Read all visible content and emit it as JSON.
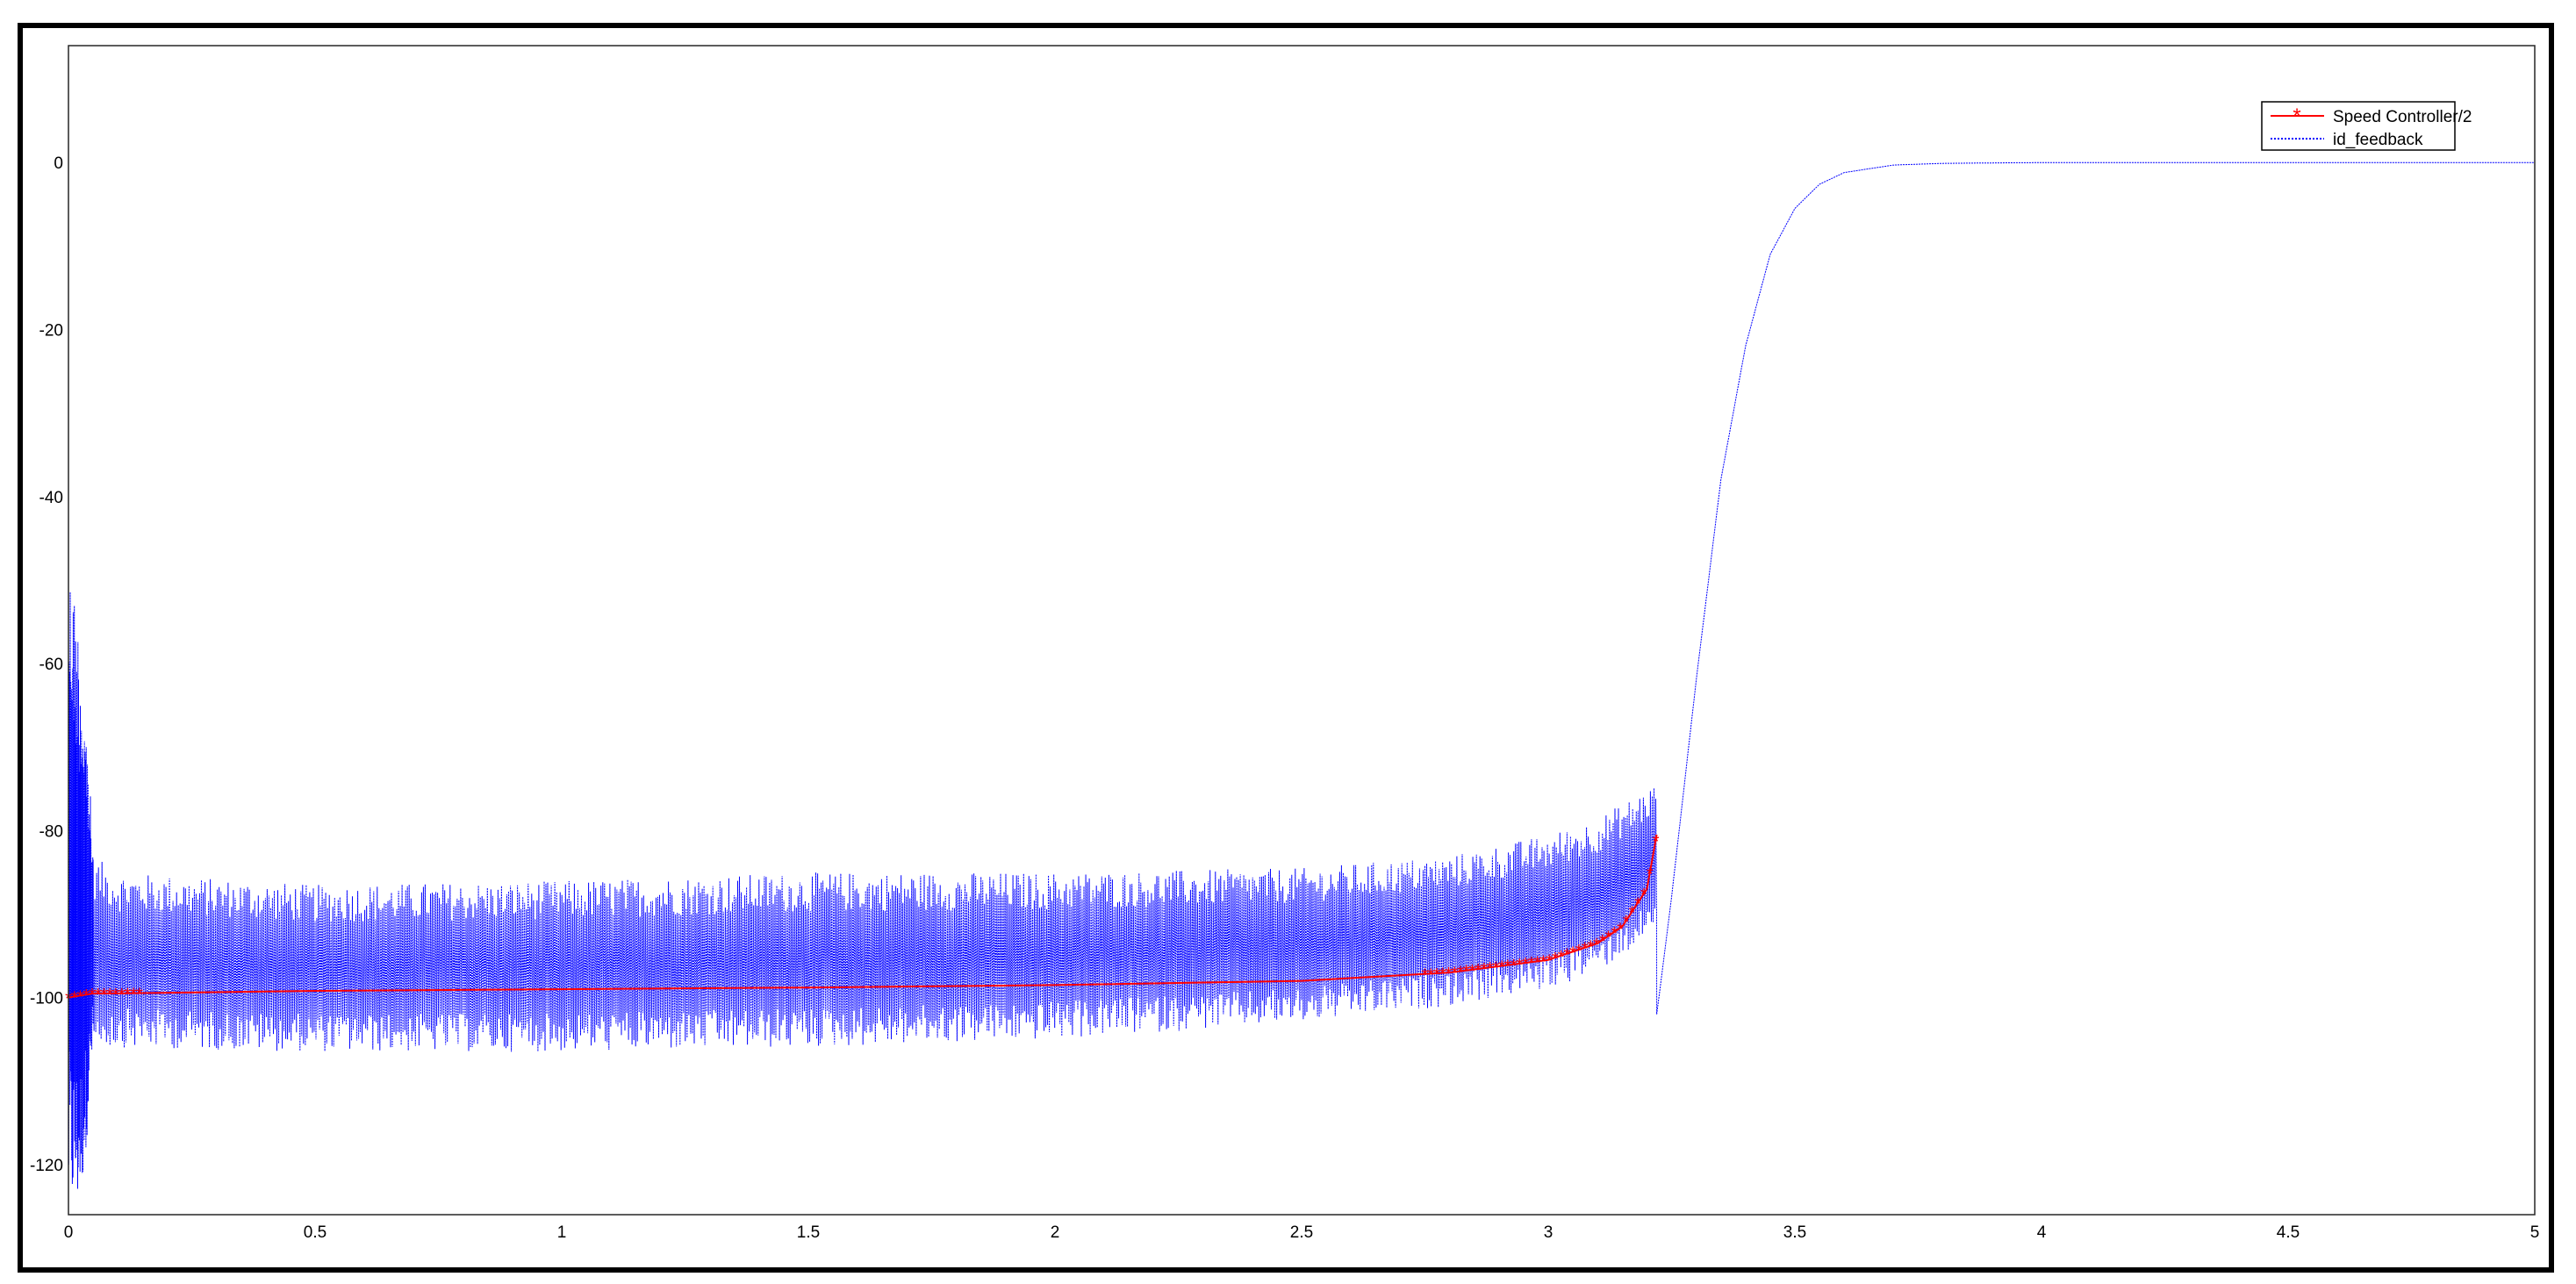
{
  "chart_data": {
    "type": "line",
    "title": "",
    "xlabel": "",
    "ylabel": "",
    "xlim": [
      0,
      5
    ],
    "ylim": [
      -126,
      14
    ],
    "grid": true,
    "legend_position": "top-right",
    "x_ticks": [
      "0",
      "0.5",
      "1",
      "1.5",
      "2",
      "2.5",
      "3",
      "3.5",
      "4",
      "4.5",
      "5"
    ],
    "y_ticks": [
      "0",
      "-20",
      "-40",
      "-60",
      "-80",
      "-100",
      "-120"
    ],
    "x_tick_values": [
      0,
      0.5,
      1,
      1.5,
      2,
      2.5,
      3,
      3.5,
      4,
      4.5,
      5
    ],
    "y_tick_values": [
      0,
      -20,
      -40,
      -60,
      -80,
      -100,
      -120
    ],
    "series": [
      {
        "name": "Speed Controller/2",
        "color": "#ff0000",
        "marker": "asterisk",
        "style": "solid",
        "description_points": {
          "x": [
            0.0,
            0.05,
            0.1,
            0.5,
            1.0,
            1.5,
            2.0,
            2.5,
            2.8,
            3.0,
            3.1,
            3.15,
            3.2,
            3.22
          ],
          "y": [
            -100,
            -99.5,
            -99.5,
            -99.2,
            -99,
            -98.8,
            -98.5,
            -98,
            -97,
            -95.5,
            -93.5,
            -91.5,
            -87,
            -80.5
          ]
        }
      },
      {
        "name": "id_feedback",
        "color": "#0000ff",
        "marker": "none",
        "style": "dotted",
        "envelope": {
          "x": [
            0.05,
            0.1,
            0.5,
            1.0,
            1.5,
            2.0,
            2.5,
            2.8,
            3.0,
            3.1,
            3.2,
            3.22
          ],
          "upper": [
            -83,
            -85,
            -86.5,
            -86,
            -85,
            -85,
            -84.5,
            -83,
            -80.5,
            -78.5,
            -75,
            -74
          ],
          "lower": [
            -106,
            -106,
            -106.5,
            -106.5,
            -106,
            -105,
            -103,
            -101,
            -99,
            -97,
            -93,
            -91
          ]
        },
        "startup_transient": {
          "x": [
            0.0,
            0.01,
            0.02,
            0.03,
            0.04,
            0.05
          ],
          "upper": [
            -47,
            -50,
            -55,
            -62,
            -70,
            -83
          ],
          "lower": [
            -126,
            -126,
            -126,
            -122,
            -115,
            -106
          ]
        },
        "recovery": {
          "x": [
            3.22,
            3.25,
            3.3,
            3.35,
            3.4,
            3.45,
            3.5,
            3.55,
            3.6,
            3.7,
            3.8,
            4.0,
            5.0
          ],
          "y": [
            -102,
            -88,
            -62,
            -38,
            -22,
            -11,
            -5.5,
            -2.6,
            -1.2,
            -0.3,
            -0.1,
            0,
            0
          ]
        }
      }
    ]
  }
}
